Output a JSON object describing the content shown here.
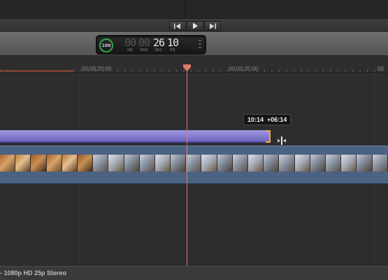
{
  "viewer": {},
  "transport": {
    "buttons": [
      {
        "name": "previous-edit",
        "icon": "skip-back-icon"
      },
      {
        "name": "play",
        "icon": "play-icon"
      },
      {
        "name": "next-edit",
        "icon": "skip-forward-icon"
      }
    ]
  },
  "dashboard": {
    "meter_value": "100",
    "timecode": {
      "hours": "00",
      "minutes": "00",
      "seconds": "26",
      "frames": "10"
    },
    "labels": {
      "hours": "HR",
      "minutes": "MIN",
      "seconds": "SEC",
      "frames": "FR"
    },
    "meter_color": "#2fa84f"
  },
  "ruler": {
    "labels": [
      "00:00:20:00",
      "00:00:25:00",
      "00"
    ]
  },
  "timeline": {
    "tooltip": {
      "duration": "10:14",
      "delta": "+06:14"
    },
    "audio_clip_color": "#8a82d6",
    "video_clip_color": "#4b6283",
    "playhead_color": "#e07a6a",
    "trim_color": "#f2a640"
  },
  "status": {
    "text": "- 1080p HD 25p Stereo"
  }
}
